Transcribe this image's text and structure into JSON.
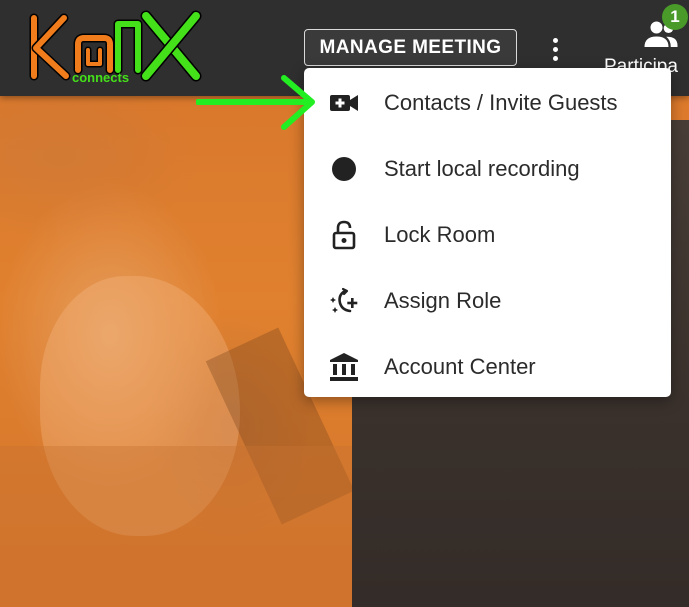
{
  "app": {
    "logo_text": "KONX",
    "logo_subtext": "connects"
  },
  "toolbar": {
    "manage_meeting_label": "MANAGE MEETING",
    "more_icon": "more-vert-icon",
    "participants_label": "Participa",
    "participants_count": "1",
    "participants_icon": "people-icon"
  },
  "menu": {
    "items": [
      {
        "label": "Contacts / Invite Guests",
        "icon": "video-add-icon"
      },
      {
        "label": "Start local recording",
        "icon": "record-icon"
      },
      {
        "label": "Lock Room",
        "icon": "lock-open-icon"
      },
      {
        "label": "Assign Role",
        "icon": "assign-role-icon"
      },
      {
        "label": "Account Center",
        "icon": "bank-icon"
      }
    ]
  },
  "colors": {
    "topbar_bg": "#2f2f2f",
    "logo_orange": "#f07c1c",
    "logo_green": "#44e01a",
    "badge_green": "#4a9a2a",
    "annotation_green": "#22ee22",
    "photo_orange": "#e0812f"
  }
}
